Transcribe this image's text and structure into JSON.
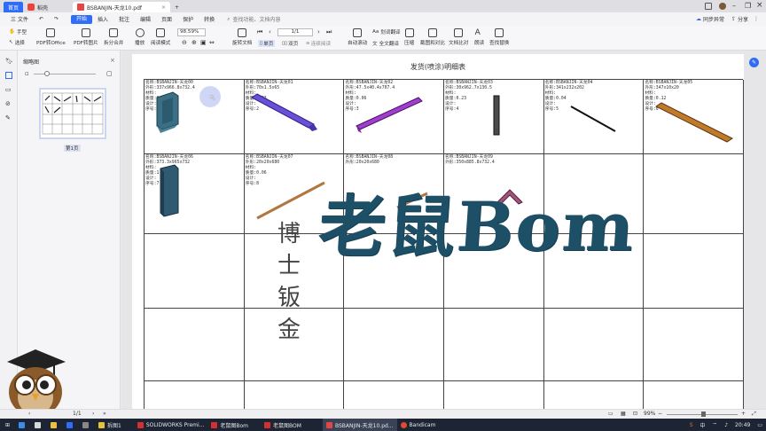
{
  "titlebar": {
    "home_tab": "首页",
    "tab2": "稻壳",
    "active_tab": "BSBANJIN-天龙10.pdf",
    "new_tab": "+"
  },
  "menubar": {
    "file": "三 文件",
    "items": [
      "开始",
      "插入",
      "批注",
      "编辑",
      "页面",
      "保护",
      "转换"
    ],
    "search": "查找功能、文档内容",
    "sync": "同步异常",
    "share": "分享"
  },
  "toolbar": {
    "hand": "手型",
    "select": "选择",
    "pdf_office": "PDF转Office",
    "pdf_image": "PDF转图片",
    "split_merge": "拆分合并",
    "play": "播放",
    "read_mode": "阅读模式",
    "zoom": "98.59%",
    "page": "1/1",
    "rotate": "旋转文档",
    "single": "单页",
    "double": "双页",
    "continuous": "连续阅读",
    "auto_scroll": "自动滚动",
    "translate": "划词翻译",
    "full_translate": "全文翻译",
    "compress": "压缩",
    "screenshot": "截图和对比",
    "compare": "文档比对",
    "read_aloud": "朗读",
    "find_replace": "查找替换"
  },
  "thumbpanel": {
    "title": "缩略图",
    "page_label": "第1页"
  },
  "document": {
    "title": "发货(喷涂)明细表",
    "cells": [
      {
        "name": "名称:BSBANJIN-天龙00",
        "size": "外形:337x966.8x732.4",
        "material": "材料:",
        "mass": "质量:0.28",
        "design": "设计:",
        "seq": "序号:1"
      },
      {
        "name": "名称:BSBANJIN-天龙01",
        "size": "外形:70x1.5x65",
        "material": "材料:",
        "mass": "质量:0.03",
        "design": "设计:",
        "seq": "序号:2"
      },
      {
        "name": "名称:BSBANJIN-天龙02",
        "size": "外形:47.5x40.4x707.4",
        "material": "材料:",
        "mass": "质量:0.06",
        "design": "设计:",
        "seq": "序号:3"
      },
      {
        "name": "名称:BSBANJIN-天龙03",
        "size": "外形:30x962.7x130.5",
        "material": "材料:",
        "mass": "质量:0.23",
        "design": "设计:",
        "seq": "序号:4"
      },
      {
        "name": "名称:BSBANJIN-天龙04",
        "size": "外形:341x232x202",
        "material": "材料:",
        "mass": "质量:0.04",
        "design": "设计:",
        "seq": "序号:5"
      },
      {
        "name": "名称:BSBANJIN-天龙05",
        "size": "外形:347x10x20",
        "material": "材料:",
        "mass": "质量:0.12",
        "design": "设计:",
        "seq": "序号:6"
      },
      {
        "name": "名称:BSBANJIN-天龙06",
        "size": "外形:373.3x965x732",
        "material": "材料:",
        "mass": "质量:1.42",
        "design": "设计:",
        "seq": "序号:7"
      },
      {
        "name": "名称:BSBANJIN-天龙07",
        "size": "外形:20x20x680",
        "material": "材料:",
        "mass": "质量:0.06",
        "design": "设计:",
        "seq": "序号:8"
      },
      {
        "name": "名称:BSBANJIN-天龙08",
        "size": "外形:20x20x680",
        "material": "",
        "mass": "",
        "design": "",
        "seq": ""
      },
      {
        "name": "名称:BSBANJIN-天龙09",
        "size": "外形:350x885.8x732.4",
        "material": "",
        "mass": "",
        "design": "",
        "seq": ""
      }
    ]
  },
  "overlay": {
    "big_title": "老鼠Bom",
    "side_title": "博士钣金"
  },
  "statusbar": {
    "page": "1/1",
    "zoom": "99%"
  },
  "taskbar": {
    "items": [
      "拆图1",
      "SOLIDWORKS Premi...",
      "老鼠图Bom",
      "老鼠图BOM",
      "BSBANJIN-天龙10.pd...",
      "Bandicam"
    ],
    "ime": "中",
    "time": "20:49"
  },
  "colors": {
    "accent": "#2f6df6",
    "calligraphy": "#1d4f66",
    "taskbar": "#1d2433"
  }
}
